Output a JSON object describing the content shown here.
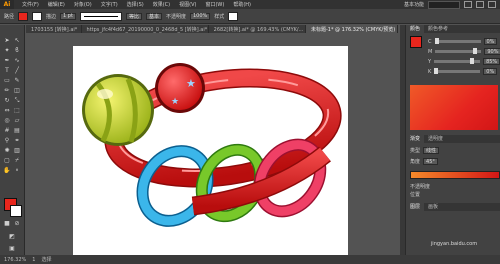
{
  "app": {
    "logo": "Ai"
  },
  "menu": [
    "文件(F)",
    "编辑(E)",
    "对象(O)",
    "文字(T)",
    "选择(S)",
    "效果(C)",
    "视图(V)",
    "窗口(W)",
    "帮助(H)"
  ],
  "workspace": "基本功能",
  "control_bar": {
    "object_label": "路径",
    "stroke_label": "描边",
    "stroke_weight": "1 pt",
    "style_label": "等比",
    "brush_value": "基本",
    "opacity_label": "不透明度",
    "opacity_value": "100%",
    "style2_label": "样式"
  },
  "doc_tabs": [
    {
      "label": "1703155 [转换].ai*",
      "active": false
    },
    {
      "label": "https_jfc4f4d67_20190000_0_2468d_5 [转换].ai*",
      "active": false
    },
    {
      "label": "2682[转换].ai* @ 169.43% (CMYK/...",
      "active": false
    },
    {
      "label": "未标题-1* @ 176.32% (CMYK/预览)",
      "active": true
    }
  ],
  "status": {
    "zoom": "176.32%",
    "page": "1",
    "tool": "选择"
  },
  "panel": {
    "tabs": [
      "颜色",
      "颜色参考"
    ],
    "rows": [
      {
        "label": "C",
        "value": "0%",
        "level": 0
      },
      {
        "label": "M",
        "value": "90%",
        "level": 0.9
      },
      {
        "label": "Y",
        "value": "85%",
        "level": 0.85
      },
      {
        "label": "K",
        "value": "0%",
        "level": 0
      }
    ],
    "gradient_tabs": [
      "渐变",
      "透明度"
    ],
    "gradient_type_label": "类型",
    "gradient_type": "线性",
    "angle_label": "角度",
    "angle_value": "45°",
    "opacity_label": "不透明度",
    "location_label": "位置",
    "bottom_tabs": [
      "图层",
      "画板"
    ],
    "watermark": "jingyan.baidu.com"
  },
  "colors": {
    "fill": "#e8261d",
    "stroke": "#ffffff",
    "accent": "#ff9a00"
  }
}
